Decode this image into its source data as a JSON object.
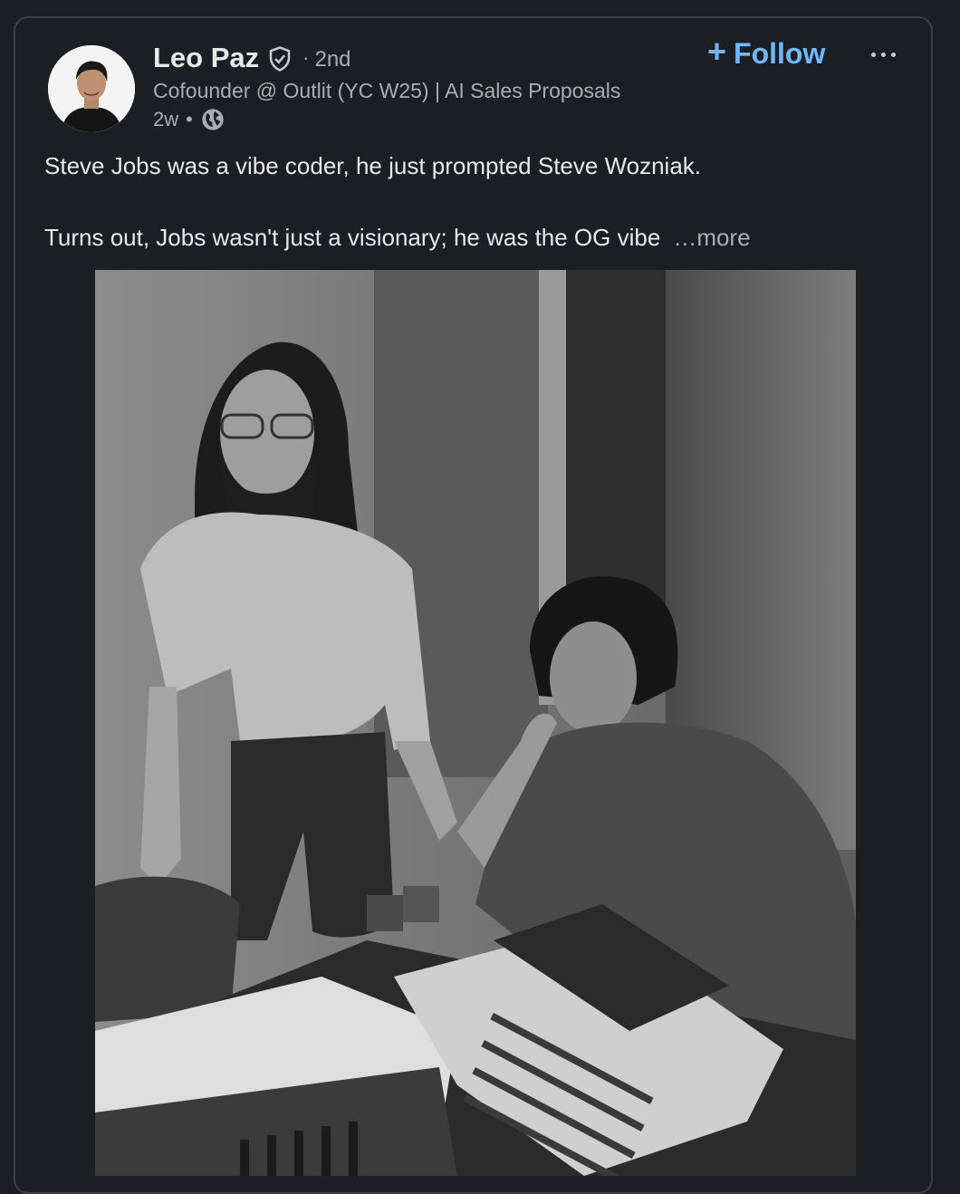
{
  "author": {
    "name": "Leo Paz",
    "degree": "2nd",
    "separator": "·",
    "headline": "Cofounder @ Outlit (YC W25) | AI Sales Proposals",
    "time": "2w",
    "time_separator": "•",
    "verified_icon": "verified-shield-icon",
    "visibility_icon": "globe-icon"
  },
  "actions": {
    "follow_plus": "+",
    "follow_label": "Follow",
    "menu_icon": "ellipsis-icon"
  },
  "post": {
    "line1": "Steve Jobs was a vibe coder, he just prompted Steve Wozniak.",
    "line2": "Turns out, Jobs wasn't just a visionary; he was the OG vibe",
    "see_more": "…more"
  },
  "colors": {
    "background": "#1b1f23",
    "text_primary": "#e9e9e9",
    "text_secondary": "#a9aeb3",
    "link_blue": "#71b7fb",
    "card_border": "#3b4046"
  }
}
